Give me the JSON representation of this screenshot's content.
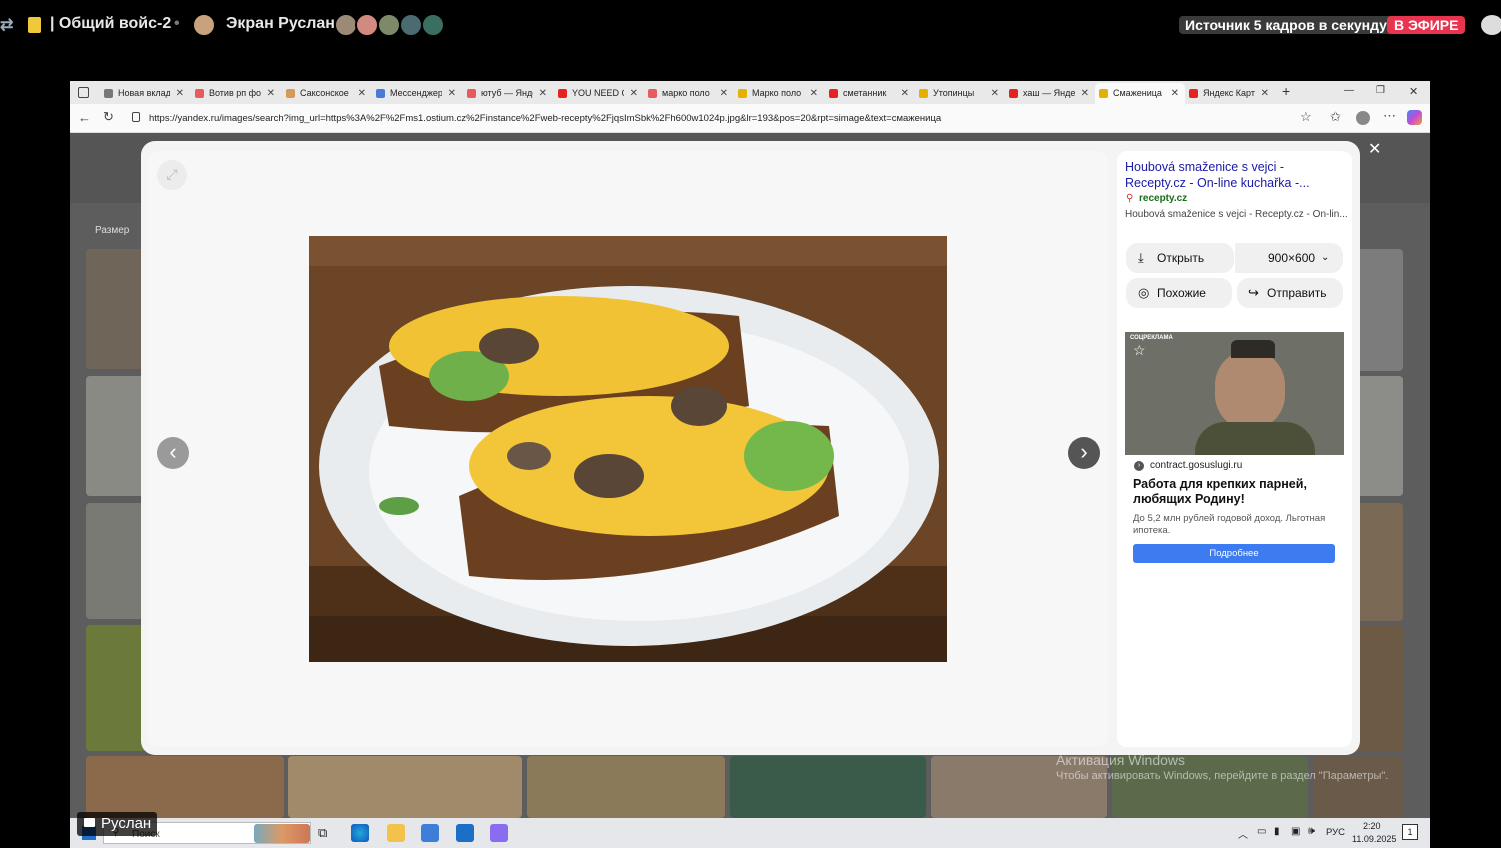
{
  "overlay": {
    "channel": "| Общий войс-2",
    "separator": "•",
    "screen_label": "Экран Руслан",
    "source_badge": "Источник 5 кадров в секунду",
    "live_badge": "В ЭФИРЕ",
    "speaker_name": "Руслан"
  },
  "browser": {
    "tabs": [
      {
        "label": "Новая вкладка",
        "color": "#777"
      },
      {
        "label": "Вотив рп фото",
        "color": "#e65c5c"
      },
      {
        "label": "Саксонское",
        "color": "#d49a5a"
      },
      {
        "label": "Мессенджер",
        "color": "#4a7ad8"
      },
      {
        "label": "ютуб — Яндекс",
        "color": "#e65c5c"
      },
      {
        "label": "YOU NEED C",
        "color": "#e62222"
      },
      {
        "label": "марко поло",
        "color": "#e65c5c"
      },
      {
        "label": "Марко поло",
        "color": "#e6b000"
      },
      {
        "label": "сметанник",
        "color": "#e62222"
      },
      {
        "label": "Утопинцы",
        "color": "#e6b000"
      },
      {
        "label": "хаш — Яндекс",
        "color": "#e62222"
      },
      {
        "label": "Смаженица",
        "color": "#e6b000"
      },
      {
        "label": "Яндекс Карты",
        "color": "#e62222"
      }
    ],
    "tab_close": "✕",
    "new_tab": "+",
    "minimize": "—",
    "restore": "❐",
    "close": "✕",
    "url": "https://yandex.ru/images/search?img_url=https%3A%2F%2Fms1.ostium.cz%2Finstance%2Fweb-recepty%2FjqsImSbk%2Fh600w1024p.jpg&lr=193&pos=20&rpt=simage&text=смаженица"
  },
  "page": {
    "filter_size": "Размер"
  },
  "modal": {
    "close": "✕",
    "prev": "‹",
    "next": "›",
    "source_title": "Houbová smaženice s vejci - Recepty.cz - On-line kuchařka -...",
    "source_domain": "recepty.cz",
    "source_desc": "Houbová smaženice s vejci - Recepty.cz - On-lin...",
    "open_label": "Открыть",
    "size_label": "900×600",
    "similar_label": "Похожие",
    "share_label": "Отправить"
  },
  "ad": {
    "tag": "СОЦРЕКЛАМА",
    "domain": "contract.gosuslugi.ru",
    "title": "Работа для крепких парней, любящих Родину!",
    "desc": "До 5,2 млн рублей годовой доход. Льготная ипотека.",
    "cta": "Подробнее"
  },
  "watermark": {
    "title": "Активация Windows",
    "text": "Чтобы активировать Windows, перейдите в раздел \"Параметры\"."
  },
  "taskbar": {
    "search": "Поиск",
    "lang": "РУС",
    "time": "2:20",
    "date": "11.09.2025",
    "notif_count": "1"
  }
}
